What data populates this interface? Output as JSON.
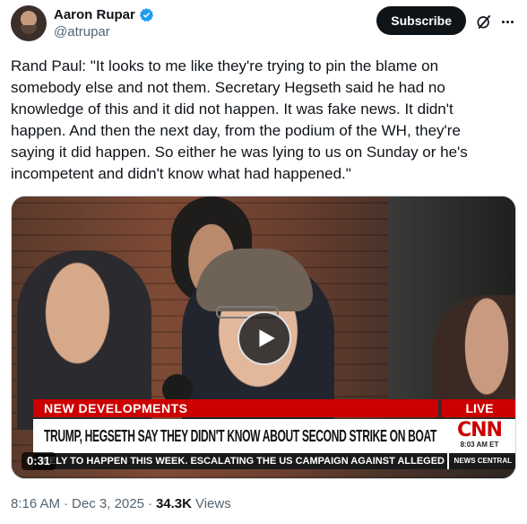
{
  "author": {
    "name": "Aaron Rupar",
    "handle": "@atrupar",
    "verified": true
  },
  "actions": {
    "subscribe_label": "Subscribe",
    "grok_icon": "grok-icon",
    "more_icon": "more-icon"
  },
  "tweet": {
    "text": "Rand Paul: \"It looks to me like they're trying to pin the blame on\nsomebody else and not them. Secretary Hegseth said he had no\nknowledge of this and it did not happen. It was fake news. It didn't\nhappen. And then the next day, from the podium of the WH, they're\nsaying it did happen. So either he was lying to us on Sunday or he's\nincompetent and didn't know what had happened.\""
  },
  "video": {
    "duration": "0:31",
    "banner_top": "NEW DEVELOPMENTS",
    "live_label": "LIVE",
    "headline": "TRUMP, HEGSETH SAY THEY DIDN'T KNOW ABOUT SECOND STRIKE ON BOAT",
    "network": "CNN",
    "time": "8:03 AM ET",
    "ticker": "RELY TO HAPPEN THIS WEEK. ESCALATING THE US CAMPAIGN AGAINST ALLEGED",
    "ticker_source": "NEWS CENTRAL"
  },
  "meta": {
    "time": "8:16 AM",
    "separator": "·",
    "date": "Dec 3, 2025",
    "views_count": "34.3K",
    "views_label": "Views"
  },
  "colors": {
    "verified_blue": "#1d9bf0",
    "cnn_red": "#cc0000",
    "text_secondary": "#536471"
  }
}
